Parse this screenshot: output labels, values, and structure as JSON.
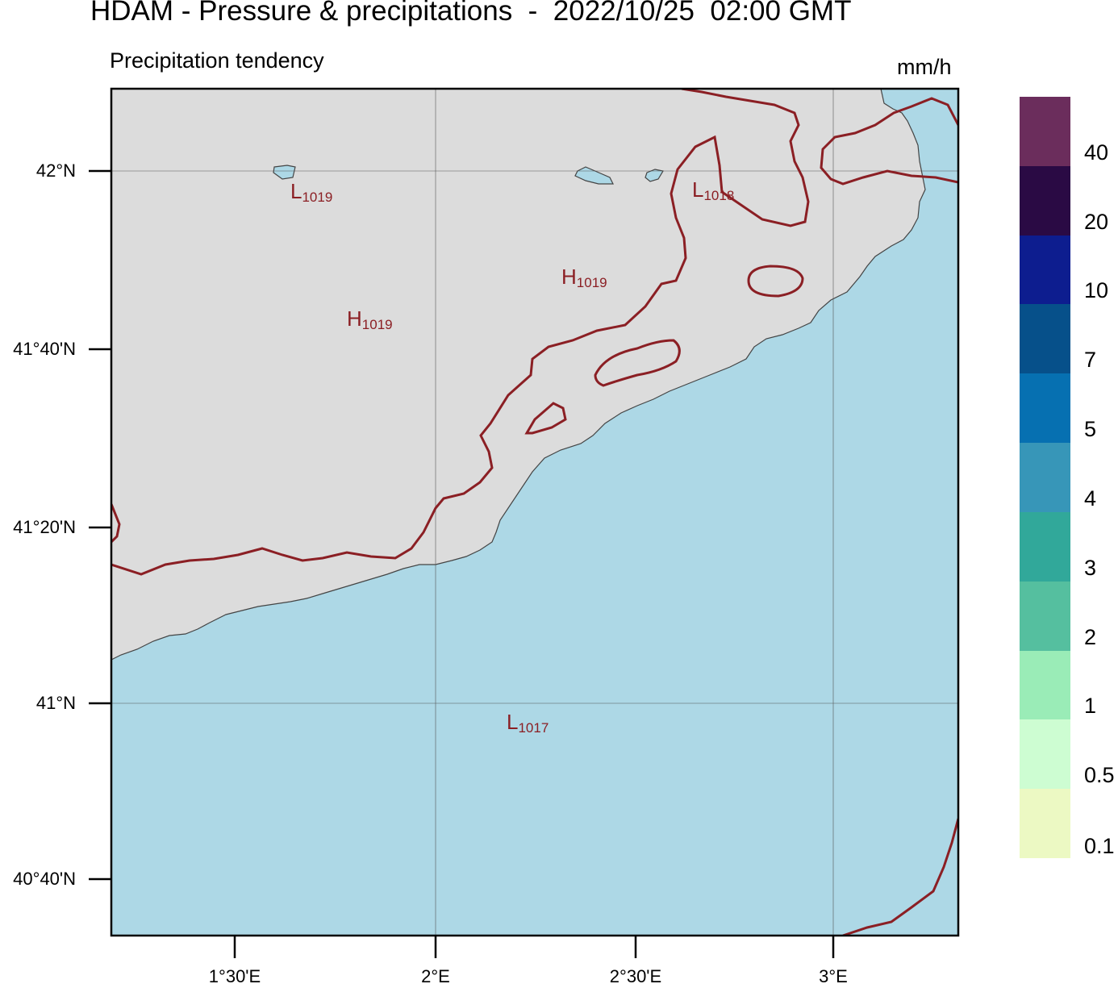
{
  "header": {
    "title": "HDAM - Pressure & precipitations  -  2022/10/25  02:00 GMT",
    "subtitle": "Precipitation tendency",
    "units": "mm/h"
  },
  "axes": {
    "lat_labels": [
      "42°N",
      "41°40'N",
      "41°20'N",
      "41°N",
      "40°40'N"
    ],
    "lon_labels": [
      "1°30'E",
      "2°E",
      "2°30'E",
      "3°E"
    ]
  },
  "pressure_labels": [
    {
      "letter": "L",
      "value": "1019"
    },
    {
      "letter": "H",
      "value": "1019"
    },
    {
      "letter": "H",
      "value": "1019"
    },
    {
      "letter": "L",
      "value": "1018"
    },
    {
      "letter": "L",
      "value": "1017"
    }
  ],
  "colorbar": {
    "labels": [
      "40",
      "20",
      "10",
      "7",
      "5",
      "4",
      "3",
      "2",
      "1",
      "0.5",
      "0.1"
    ],
    "colors": [
      "#6b2d5c",
      "#2a0a44",
      "#0d1d8f",
      "#06508a",
      "#0670b1",
      "#3796b8",
      "#31a89a",
      "#55bf9f",
      "#9aecb7",
      "#cdfdd2",
      "#ecf9c3"
    ]
  },
  "colors": {
    "land": "#dcdcdc",
    "sea": "#add8e6",
    "isobar": "#8b1f24"
  }
}
